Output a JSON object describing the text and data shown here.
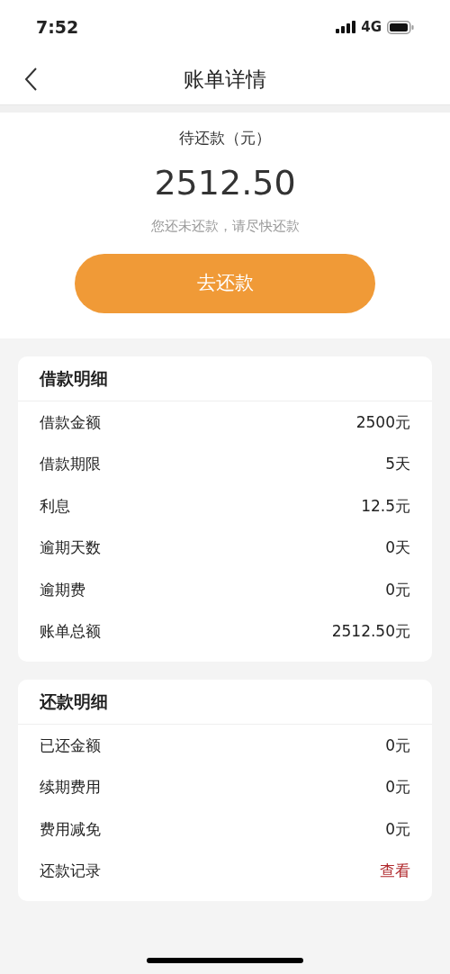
{
  "status_bar": {
    "time": "7:52",
    "network": "4G"
  },
  "nav": {
    "title": "账单详情"
  },
  "summary": {
    "label": "待还款（元）",
    "amount": "2512.50",
    "note": "您还未还款，请尽快还款",
    "button": "去还款"
  },
  "sections": [
    {
      "title": "借款明细",
      "rows": [
        {
          "label": "借款金额",
          "value": "2500元",
          "kind": "text"
        },
        {
          "label": "借款期限",
          "value": "5天",
          "kind": "text"
        },
        {
          "label": "利息",
          "value": "12.5元",
          "kind": "text"
        },
        {
          "label": "逾期天数",
          "value": "0天",
          "kind": "text"
        },
        {
          "label": "逾期费",
          "value": "0元",
          "kind": "text"
        },
        {
          "label": "账单总额",
          "value": "2512.50元",
          "kind": "text"
        }
      ]
    },
    {
      "title": "还款明细",
      "rows": [
        {
          "label": "已还金额",
          "value": "0元",
          "kind": "text"
        },
        {
          "label": "续期费用",
          "value": "0元",
          "kind": "text"
        },
        {
          "label": "费用减免",
          "value": "0元",
          "kind": "text"
        },
        {
          "label": "还款记录",
          "value": "查看",
          "kind": "link"
        }
      ]
    }
  ]
}
